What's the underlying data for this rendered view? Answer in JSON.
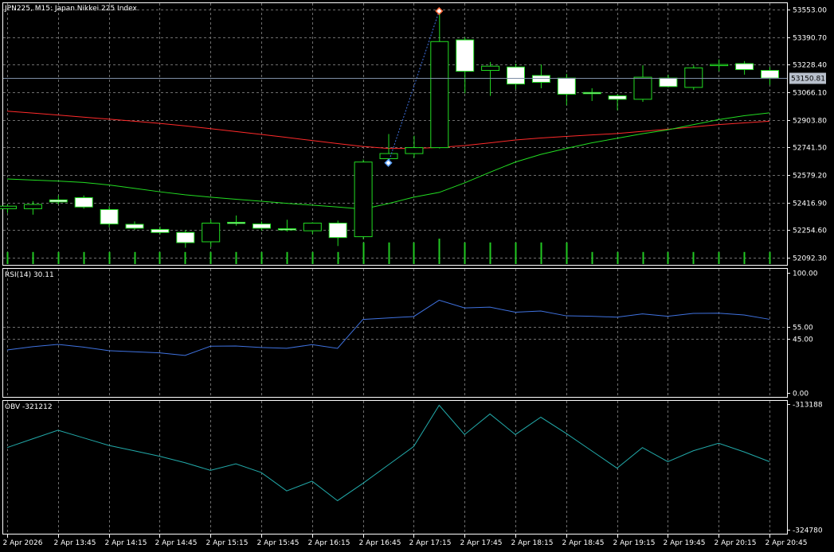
{
  "chart_data": [
    {
      "type": "candlestick",
      "title": "JPN225, M15:  Japan Nikkei 225 Index",
      "symbol": "JPN225",
      "timeframe": "M15",
      "instrument": "Japan Nikkei 225 Index",
      "x_tick_labels": [
        "2 Apr 2026",
        "2 Apr 13:45",
        "2 Apr 14:15",
        "2 Apr 14:45",
        "2 Apr 15:15",
        "2 Apr 15:45",
        "2 Apr 16:15",
        "2 Apr 16:45",
        "2 Apr 17:15",
        "2 Apr 17:45",
        "2 Apr 18:15",
        "2 Apr 18:45",
        "2 Apr 19:15",
        "2 Apr 19:45",
        "2 Apr 20:15",
        "2 Apr 20:45"
      ],
      "y_tick_labels": [
        "53553.00",
        "53390.70",
        "53228.40",
        "53066.10",
        "52903.80",
        "52741.50",
        "52579.20",
        "52416.90",
        "52254.60",
        "52092.30"
      ],
      "ylim": [
        52049,
        53596
      ],
      "current_price": "53150.81",
      "grid": true,
      "candles": [
        {
          "o": 52380,
          "h": 52405,
          "l": 52355,
          "c": 52395
        },
        {
          "o": 52380,
          "h": 52425,
          "l": 52345,
          "c": 52405
        },
        {
          "o": 52432,
          "h": 52458,
          "l": 52405,
          "c": 52420
        },
        {
          "o": 52445,
          "h": 52458,
          "l": 52380,
          "c": 52390
        },
        {
          "o": 52375,
          "h": 52395,
          "l": 52270,
          "c": 52290
        },
        {
          "o": 52288,
          "h": 52305,
          "l": 52255,
          "c": 52265
        },
        {
          "o": 52258,
          "h": 52275,
          "l": 52228,
          "c": 52240
        },
        {
          "o": 52240,
          "h": 52255,
          "l": 52150,
          "c": 52180
        },
        {
          "o": 52185,
          "h": 52315,
          "l": 52155,
          "c": 52295
        },
        {
          "o": 52300,
          "h": 52340,
          "l": 52280,
          "c": 52295
        },
        {
          "o": 52290,
          "h": 52305,
          "l": 52250,
          "c": 52265
        },
        {
          "o": 52262,
          "h": 52315,
          "l": 52245,
          "c": 52258
        },
        {
          "o": 52250,
          "h": 52300,
          "l": 52230,
          "c": 52295
        },
        {
          "o": 52295,
          "h": 52310,
          "l": 52160,
          "c": 52210
        },
        {
          "o": 52215,
          "h": 52670,
          "l": 52200,
          "c": 52655
        },
        {
          "o": 52675,
          "h": 52820,
          "l": 52640,
          "c": 52705
        },
        {
          "o": 52705,
          "h": 52810,
          "l": 52680,
          "c": 52740
        },
        {
          "o": 52740,
          "h": 53560,
          "l": 52735,
          "c": 53365
        },
        {
          "o": 53375,
          "h": 53390,
          "l": 53060,
          "c": 53190
        },
        {
          "o": 53195,
          "h": 53245,
          "l": 53045,
          "c": 53220
        },
        {
          "o": 53215,
          "h": 53235,
          "l": 53085,
          "c": 53115
        },
        {
          "o": 53165,
          "h": 53230,
          "l": 53090,
          "c": 53125
        },
        {
          "o": 53150,
          "h": 53175,
          "l": 52990,
          "c": 53055
        },
        {
          "o": 53065,
          "h": 53090,
          "l": 53015,
          "c": 53060
        },
        {
          "o": 53045,
          "h": 53055,
          "l": 52960,
          "c": 53025
        },
        {
          "o": 53025,
          "h": 53225,
          "l": 53010,
          "c": 53155
        },
        {
          "o": 53150,
          "h": 53170,
          "l": 53095,
          "c": 53100
        },
        {
          "o": 53095,
          "h": 53225,
          "l": 53080,
          "c": 53210
        },
        {
          "o": 53225,
          "h": 53260,
          "l": 53190,
          "c": 53230
        },
        {
          "o": 53235,
          "h": 53250,
          "l": 53170,
          "c": 53200
        },
        {
          "o": 53195,
          "h": 53215,
          "l": 53110,
          "c": 53150
        }
      ],
      "series": [
        {
          "type": "line",
          "color": "#ff2a2a",
          "values": [
            52955,
            52944,
            52932,
            52920,
            52908,
            52896,
            52883,
            52868,
            52852,
            52835,
            52818,
            52800,
            52782,
            52764,
            52747,
            52735,
            52735,
            52741,
            52752,
            52768,
            52785,
            52797,
            52806,
            52815,
            52823,
            52836,
            52848,
            52862,
            52876,
            52886,
            52896
          ]
        },
        {
          "type": "line",
          "color": "#22dd22",
          "values": [
            52555,
            52549,
            52543,
            52535,
            52520,
            52500,
            52480,
            52462,
            52448,
            52436,
            52424,
            52412,
            52401,
            52390,
            52378,
            52410,
            52448,
            52476,
            52532,
            52595,
            52655,
            52700,
            52735,
            52768,
            52795,
            52822,
            52845,
            52875,
            52905,
            52928,
            52945
          ]
        }
      ],
      "volume": [
        0.3,
        0.3,
        0.3,
        0.3,
        0.3,
        0.3,
        0.3,
        0.3,
        0.3,
        0.3,
        0.3,
        0.3,
        0.3,
        0.3,
        0.8,
        0.8,
        0.8,
        1.0,
        0.8,
        0.8,
        0.8,
        0.8,
        0.8,
        0.3,
        0.3,
        0.3,
        0.3,
        0.3,
        0.3,
        0.3,
        0.3
      ],
      "markers": [
        {
          "index": 15,
          "value": 52650,
          "kind": "buy"
        },
        {
          "index": 17,
          "value": 53545,
          "kind": "sell"
        }
      ]
    },
    {
      "type": "line",
      "title": "RSI(14) 30.11",
      "ylim": [
        0,
        100
      ],
      "y_tick_labels": [
        "100.00",
        "55.00",
        "45.00",
        "0.00"
      ],
      "levels": [
        55,
        45
      ],
      "series": [
        {
          "name": "RSI(14)",
          "color": "#3f72e0",
          "values": [
            35.8,
            38.5,
            40.4,
            38.2,
            35.2,
            34.3,
            33.4,
            31.2,
            38.9,
            39.1,
            37.8,
            37.2,
            40.2,
            37.1,
            61.2,
            62.4,
            63.6,
            77.2,
            70.8,
            71.4,
            67.2,
            68.2,
            64.2,
            63.8,
            63.1,
            65.8,
            63.8,
            66.2,
            66.4,
            64.9,
            61.3
          ]
        }
      ]
    },
    {
      "type": "line",
      "title": "OBV -321212",
      "ylim": [
        -324780,
        -313188
      ],
      "y_tick_labels": [
        "-313188",
        "-324780"
      ],
      "series": [
        {
          "name": "OBV",
          "color": "#22aaaa",
          "values": [
            -317200,
            -316400,
            -315600,
            -316300,
            -317000,
            -317500,
            -318000,
            -318600,
            -319300,
            -318700,
            -319500,
            -321200,
            -320300,
            -322100,
            -320500,
            -318800,
            -317100,
            -313300,
            -316000,
            -314100,
            -316000,
            -314400,
            -315900,
            -317500,
            -319100,
            -317200,
            -318500,
            -317500,
            -316800,
            -317600,
            -318500
          ]
        }
      ]
    }
  ]
}
